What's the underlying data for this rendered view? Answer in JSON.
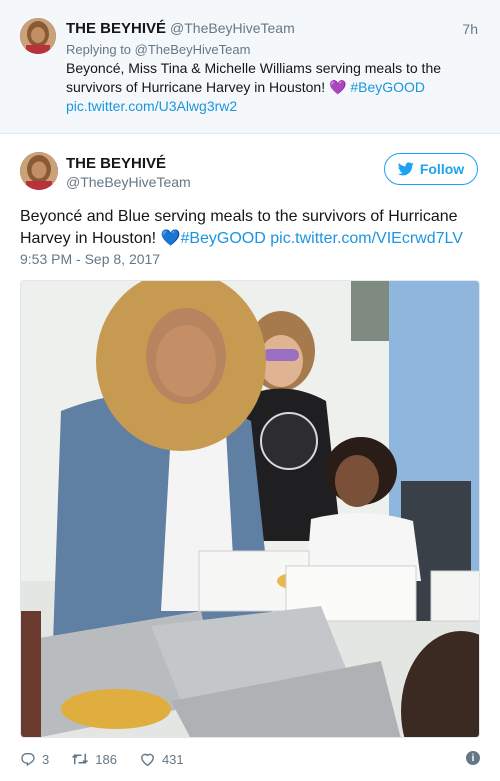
{
  "reply_tweet": {
    "name": "THE BEYHIVÉ",
    "handle": "@TheBeyHiveTeam",
    "time": "7h",
    "replying_to": "Replying to @TheBeyHiveTeam",
    "text": "Beyoncé, Miss Tina & Michelle Williams serving meals to the survivors of Hurricane Harvey in Houston! ",
    "emoji": "💜",
    "hashtag": "#BeyGOOD",
    "link": "pic.twitter.com/U3Alwg3rw2"
  },
  "main_tweet": {
    "name": "THE BEYHIVÉ",
    "handle": "@TheBeyHiveTeam",
    "follow_label": "Follow",
    "text": "Beyoncé and Blue serving meals to the survivors of Hurricane Harvey in Houston! ",
    "emoji": "💙",
    "hashtag": "#BeyGOOD",
    "link": "pic.twitter.com/VIEcrwd7LV",
    "timestamp": "9:53 PM - Sep 8, 2017"
  },
  "actions": {
    "replies": "3",
    "retweets": "186",
    "likes": "431"
  },
  "colors": {
    "accent": "#1da1f2",
    "link": "#1b95e0",
    "muted": "#657786"
  },
  "icons": {
    "follow": "twitter-bird-icon",
    "reply": "reply-icon",
    "retweet": "retweet-icon",
    "like": "heart-icon",
    "info": "info-icon"
  }
}
